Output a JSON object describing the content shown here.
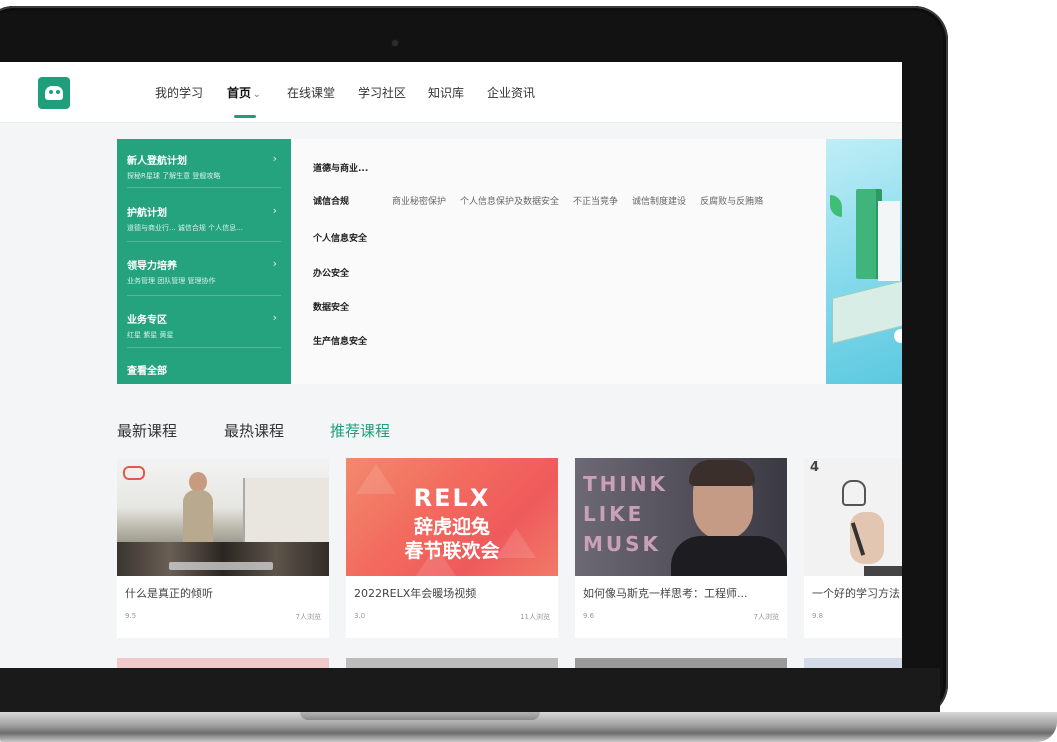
{
  "nav": {
    "items": [
      "我的学习",
      "首页",
      "在线课堂",
      "学习社区",
      "知识库",
      "企业资讯"
    ],
    "active_index": 1,
    "dropdown_glyph": "⌄"
  },
  "categories": [
    {
      "title": "新人登航计划",
      "subtitle": "探秘R星球  了解生意  登舰攻略"
    },
    {
      "title": "护航计划",
      "subtitle": "道德与商业行...  诚信合规  个人信息..."
    },
    {
      "title": "领导力培养",
      "subtitle": "业务管理  团队管理  管理协作"
    },
    {
      "title": "业务专区",
      "subtitle": "红星  紫星  黄星"
    }
  ],
  "see_all": "查看全部",
  "subcategories": {
    "rows": [
      "道德与商业...",
      "诚信合规",
      "个人信息安全",
      "办公安全",
      "数据安全",
      "生产信息安全"
    ],
    "tags": [
      "商业秘密保护",
      "个人信息保护及数据安全",
      "不正当竞争",
      "诚信制度建设",
      "反腐败与反贿赂"
    ]
  },
  "course_tabs": {
    "items": [
      "最新课程",
      "最热课程",
      "推荐课程"
    ],
    "active_index": 2
  },
  "courses": [
    {
      "title": "什么是真正的倾听",
      "rating": "9.5",
      "views": "7人浏览"
    },
    {
      "title": "2022RELX年会暖场视频",
      "rating": "3.0",
      "views": "11人浏览",
      "thumb_lines": [
        "RELX",
        "辞虎迎兔",
        "春节联欢会"
      ]
    },
    {
      "title": "如何像马斯克一样思考：工程师...",
      "rating": "9.6",
      "views": "7人浏览",
      "thumb_lines": [
        "THINK",
        "LIKE",
        "MUSK"
      ]
    },
    {
      "title": "一个好的学习方法",
      "rating": "9.8",
      "views": "",
      "thumb_number": "4"
    }
  ],
  "colors": {
    "brand": "#1e9e7b",
    "category_panel": "#25a37f"
  },
  "icons": [
    "logo-icon",
    "chevron-down-icon",
    "chevron-right-icon"
  ]
}
